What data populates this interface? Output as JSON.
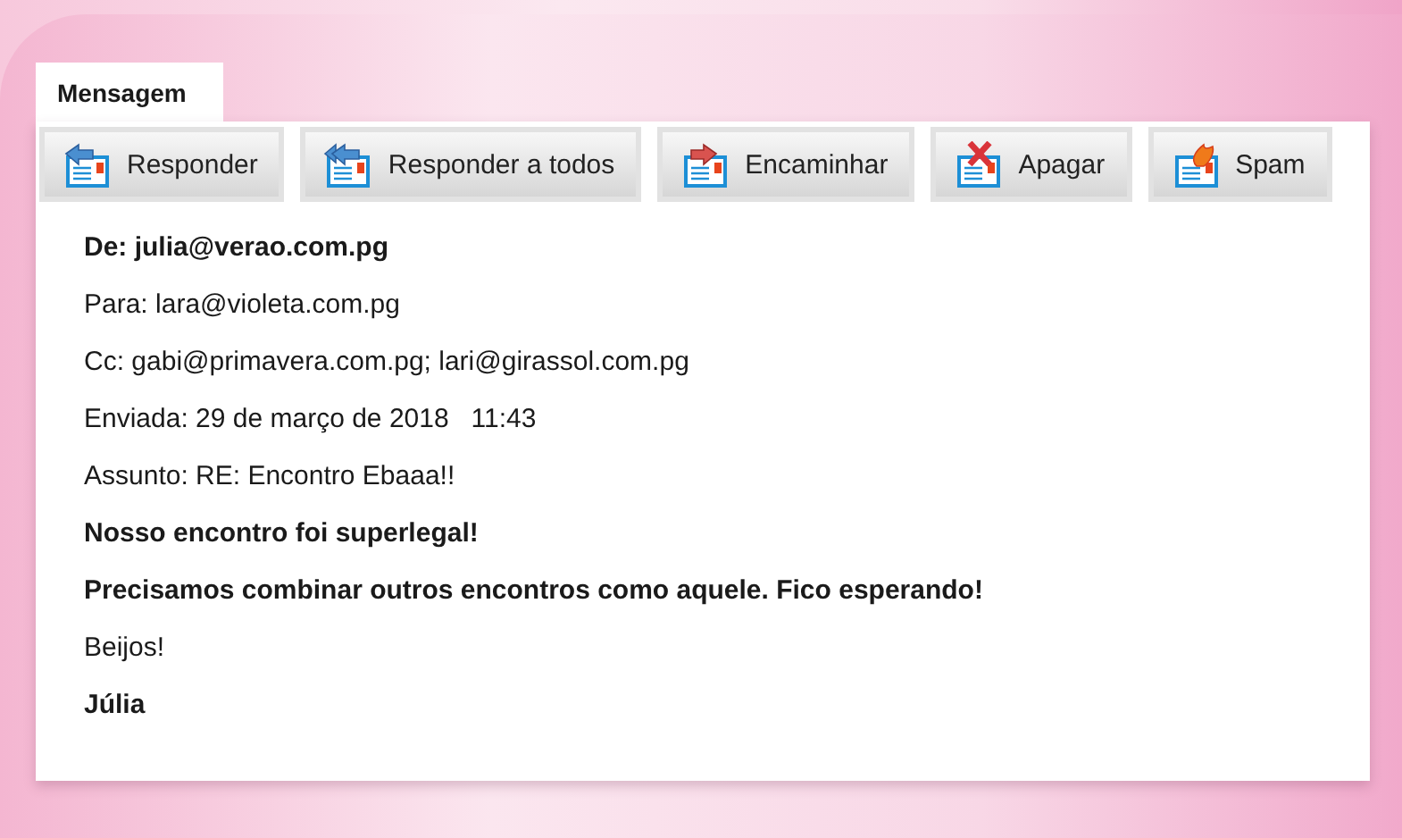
{
  "tab": {
    "label": "Mensagem",
    "selected": true
  },
  "toolbar": [
    {
      "kind": "reply",
      "label": "Responder"
    },
    {
      "kind": "reply-all",
      "label": "Responder a todos"
    },
    {
      "kind": "forward",
      "label": "Encaminhar"
    },
    {
      "kind": "delete",
      "label": "Apagar"
    },
    {
      "kind": "spam",
      "label": "Spam"
    }
  ],
  "message": [
    {
      "text": "De: julia@verao.com.pg",
      "bold": true
    },
    {
      "text": "Para: lara@violeta.com.pg",
      "bold": false
    },
    {
      "text": "Cc: gabi@primavera.com.pg; lari@girassol.com.pg",
      "bold": false
    },
    {
      "text": "Enviada: 29 de março de 2018   11:43",
      "bold": false
    },
    {
      "text": "Assunto: RE: Encontro Ebaaa!!",
      "bold": false
    },
    {
      "text": "Nosso encontro foi superlegal!",
      "bold": true
    },
    {
      "text": "Precisamos combinar outros encontros como aquele. Fico esperando!",
      "bold": true
    },
    {
      "text": "Beijos!",
      "bold": false
    },
    {
      "text": "Júlia",
      "bold": true
    }
  ]
}
